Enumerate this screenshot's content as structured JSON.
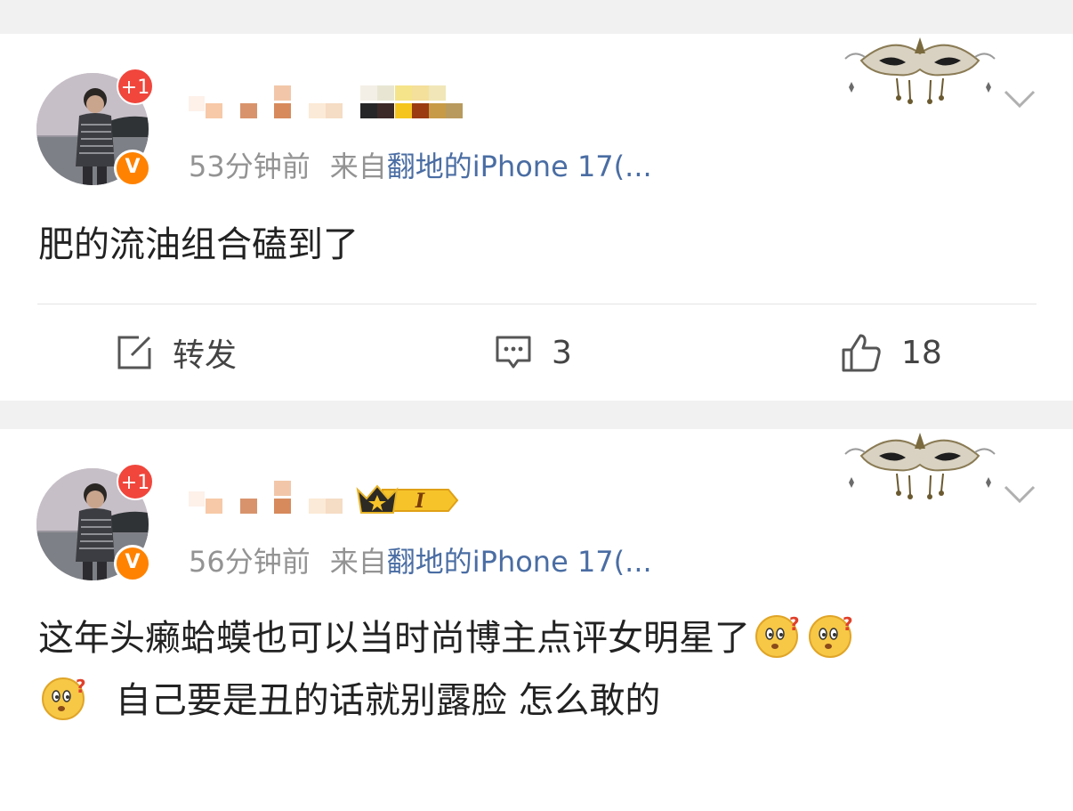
{
  "posts": [
    {
      "avatar_badge": "+1",
      "verified_badge": "V",
      "time": "53分钟前",
      "source_prefix": "来自",
      "device": "翻地的iPhone 17(...",
      "text": "肥的流油组合磕到了",
      "actions": {
        "repost_label": "转发",
        "comment_count": "3",
        "like_count": "18"
      }
    },
    {
      "avatar_badge": "+1",
      "verified_badge": "V",
      "vip_level": "I",
      "time": "56分钟前",
      "source_prefix": "来自",
      "device": "翻地的iPhone 17(...",
      "text_line1": "这年头癞蛤蟆也可以当时尚博主点评女明星了",
      "text_line2": "自己要是丑的话就别露脸 怎么敢的"
    }
  ],
  "icons": {
    "repost": "edit-square-icon",
    "comment": "comment-bubble-icon",
    "like": "thumbs-up-icon",
    "more": "chevron-down-icon",
    "emoji": "confused-face-emoji",
    "decoration": "masquerade-mask-icon"
  },
  "colors": {
    "badge_red": "#f0463c",
    "verified_orange": "#ff8200",
    "link_blue": "#4a6da3",
    "meta_gray": "#939393"
  }
}
